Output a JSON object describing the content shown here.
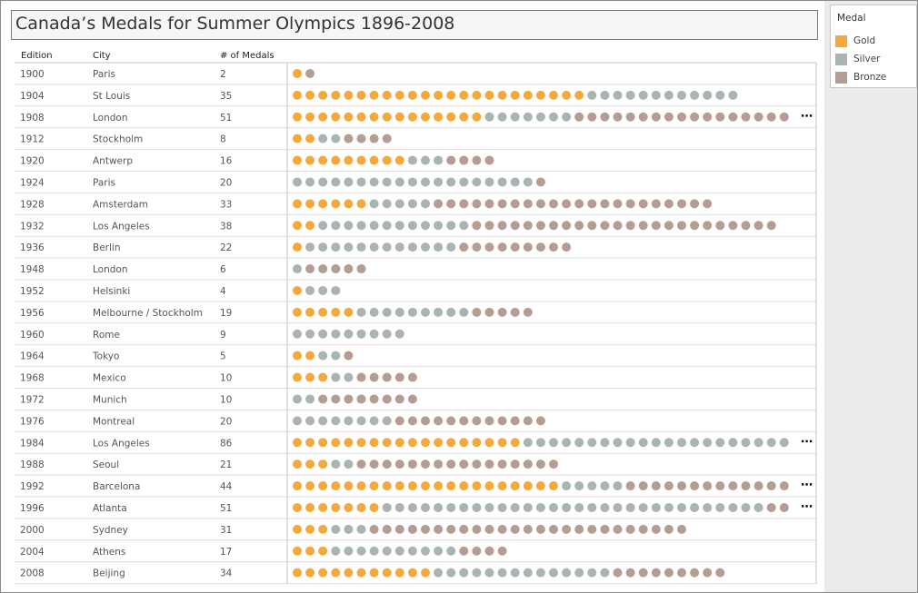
{
  "chart_data": {
    "type": "table",
    "title": "Canada’s Medals for Summer Olympics 1896-2008",
    "columns": [
      "Edition",
      "City",
      "# of Medals"
    ],
    "legend": {
      "title": "Medal",
      "items": [
        {
          "name": "Gold",
          "color": "#f5a93c"
        },
        {
          "name": "Silver",
          "color": "#aab4b0"
        },
        {
          "name": "Bronze",
          "color": "#b59d93"
        }
      ]
    },
    "rows": [
      {
        "edition": "1900",
        "city": "Paris",
        "medals": "2",
        "gold": 1,
        "silver": 0,
        "bronze": 1
      },
      {
        "edition": "1904",
        "city": "St Louis",
        "medals": "35",
        "gold": 23,
        "silver": 12,
        "bronze": 0
      },
      {
        "edition": "1908",
        "city": "London",
        "medals": "51",
        "gold": 15,
        "silver": 7,
        "bronze": 29
      },
      {
        "edition": "1912",
        "city": "Stockholm",
        "medals": "8",
        "gold": 2,
        "silver": 2,
        "bronze": 4
      },
      {
        "edition": "1920",
        "city": "Antwerp",
        "medals": "16",
        "gold": 9,
        "silver": 3,
        "bronze": 4
      },
      {
        "edition": "1924",
        "city": "Paris",
        "medals": "20",
        "gold": 0,
        "silver": 19,
        "bronze": 1
      },
      {
        "edition": "1928",
        "city": "Amsterdam",
        "medals": "33",
        "gold": 6,
        "silver": 5,
        "bronze": 22
      },
      {
        "edition": "1932",
        "city": "Los Angeles",
        "medals": "38",
        "gold": 2,
        "silver": 12,
        "bronze": 24
      },
      {
        "edition": "1936",
        "city": "Berlin",
        "medals": "22",
        "gold": 1,
        "silver": 12,
        "bronze": 9
      },
      {
        "edition": "1948",
        "city": "London",
        "medals": "6",
        "gold": 0,
        "silver": 1,
        "bronze": 5
      },
      {
        "edition": "1952",
        "city": "Helsinki",
        "medals": "4",
        "gold": 1,
        "silver": 3,
        "bronze": 0
      },
      {
        "edition": "1956",
        "city": "Melbourne / Stockholm",
        "medals": "19",
        "gold": 5,
        "silver": 9,
        "bronze": 5
      },
      {
        "edition": "1960",
        "city": "Rome",
        "medals": "9",
        "gold": 0,
        "silver": 9,
        "bronze": 0
      },
      {
        "edition": "1964",
        "city": "Tokyo",
        "medals": "5",
        "gold": 2,
        "silver": 2,
        "bronze": 1
      },
      {
        "edition": "1968",
        "city": "Mexico",
        "medals": "10",
        "gold": 3,
        "silver": 2,
        "bronze": 5
      },
      {
        "edition": "1972",
        "city": "Munich",
        "medals": "10",
        "gold": 0,
        "silver": 2,
        "bronze": 8
      },
      {
        "edition": "1976",
        "city": "Montreal",
        "medals": "20",
        "gold": 0,
        "silver": 8,
        "bronze": 12
      },
      {
        "edition": "1984",
        "city": "Los Angeles",
        "medals": "86",
        "gold": 18,
        "silver": 68,
        "bronze": 0
      },
      {
        "edition": "1988",
        "city": "Seoul",
        "medals": "21",
        "gold": 3,
        "silver": 2,
        "bronze": 16
      },
      {
        "edition": "1992",
        "city": "Barcelona",
        "medals": "44",
        "gold": 21,
        "silver": 5,
        "bronze": 18
      },
      {
        "edition": "1996",
        "city": "Atlanta",
        "medals": "51",
        "gold": 7,
        "silver": 30,
        "bronze": 14
      },
      {
        "edition": "2000",
        "city": "Sydney",
        "medals": "31",
        "gold": 3,
        "silver": 3,
        "bronze": 25
      },
      {
        "edition": "2004",
        "city": "Athens",
        "medals": "17",
        "gold": 3,
        "silver": 10,
        "bronze": 4
      },
      {
        "edition": "2008",
        "city": "Beijing",
        "medals": "34",
        "gold": 11,
        "silver": 14,
        "bronze": 9
      }
    ]
  }
}
